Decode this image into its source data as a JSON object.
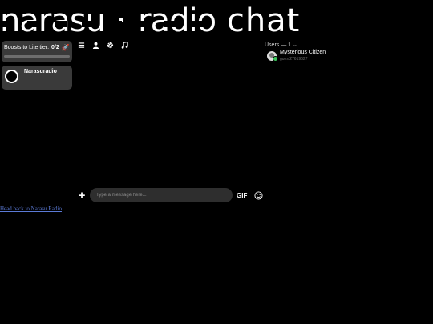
{
  "header": {
    "logo_scrambled": "narasu",
    "logo_scrambled_2": "radio",
    "logo_suffix": "chat"
  },
  "sidebar": {
    "boost_label": "Boosts to Lite tier:",
    "boost_count": "0/2",
    "boost_progress": 0,
    "servers": [
      {
        "name": "Narasuradio"
      }
    ]
  },
  "toolbar": {
    "icons": [
      "menu-icon",
      "user-icon",
      "gear-icon",
      "music-icon"
    ]
  },
  "users": {
    "header": "Users — 1",
    "list": [
      {
        "name": "Mysterious Citizen",
        "id": "guest27619627",
        "status": "online"
      }
    ]
  },
  "composer": {
    "placeholder": "Type a message here...",
    "gif_label": "GIF"
  },
  "footer": {
    "back_link": "Head back to Narasu Radio"
  },
  "colors": {
    "background": "#000000",
    "card": "#3a3a3a",
    "input": "#2e2e2e",
    "online": "#3ac55b",
    "link": "#5b7ad6"
  }
}
